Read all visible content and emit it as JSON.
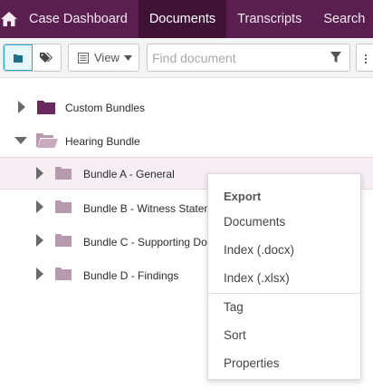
{
  "nav": {
    "home_icon": "home-icon",
    "tabs": [
      {
        "label": "Case Dashboard",
        "active": false
      },
      {
        "label": "Documents",
        "active": true
      },
      {
        "label": "Transcripts",
        "active": false
      },
      {
        "label": "Search",
        "active": false
      }
    ]
  },
  "toolbar": {
    "toggle_folder_icon": "folder-icon",
    "toggle_tag_icon": "tag-icon",
    "view_label": "View",
    "search_placeholder": "Find document",
    "search_value": ""
  },
  "tree": {
    "groups": [
      {
        "label": "Custom Bundles",
        "expanded": false
      },
      {
        "label": "Hearing Bundle",
        "expanded": true
      }
    ],
    "children": [
      {
        "label": "Bundle A - General",
        "selected": true
      },
      {
        "label": "Bundle B - Witness Statem"
      },
      {
        "label": "Bundle C - Supporting Doc"
      },
      {
        "label": "Bundle D - Findings"
      }
    ]
  },
  "context_menu": {
    "header": "Export",
    "items": [
      "Documents",
      "Index (.docx)",
      "Index (.xlsx)",
      "Tag",
      "Sort",
      "Properties"
    ]
  },
  "colors": {
    "nav_bg": "#5b1f4f",
    "nav_active": "#3f1236",
    "folder_dark": "#6b2a5d",
    "folder_light": "#b89aae",
    "accent": "#2aa6cf"
  }
}
